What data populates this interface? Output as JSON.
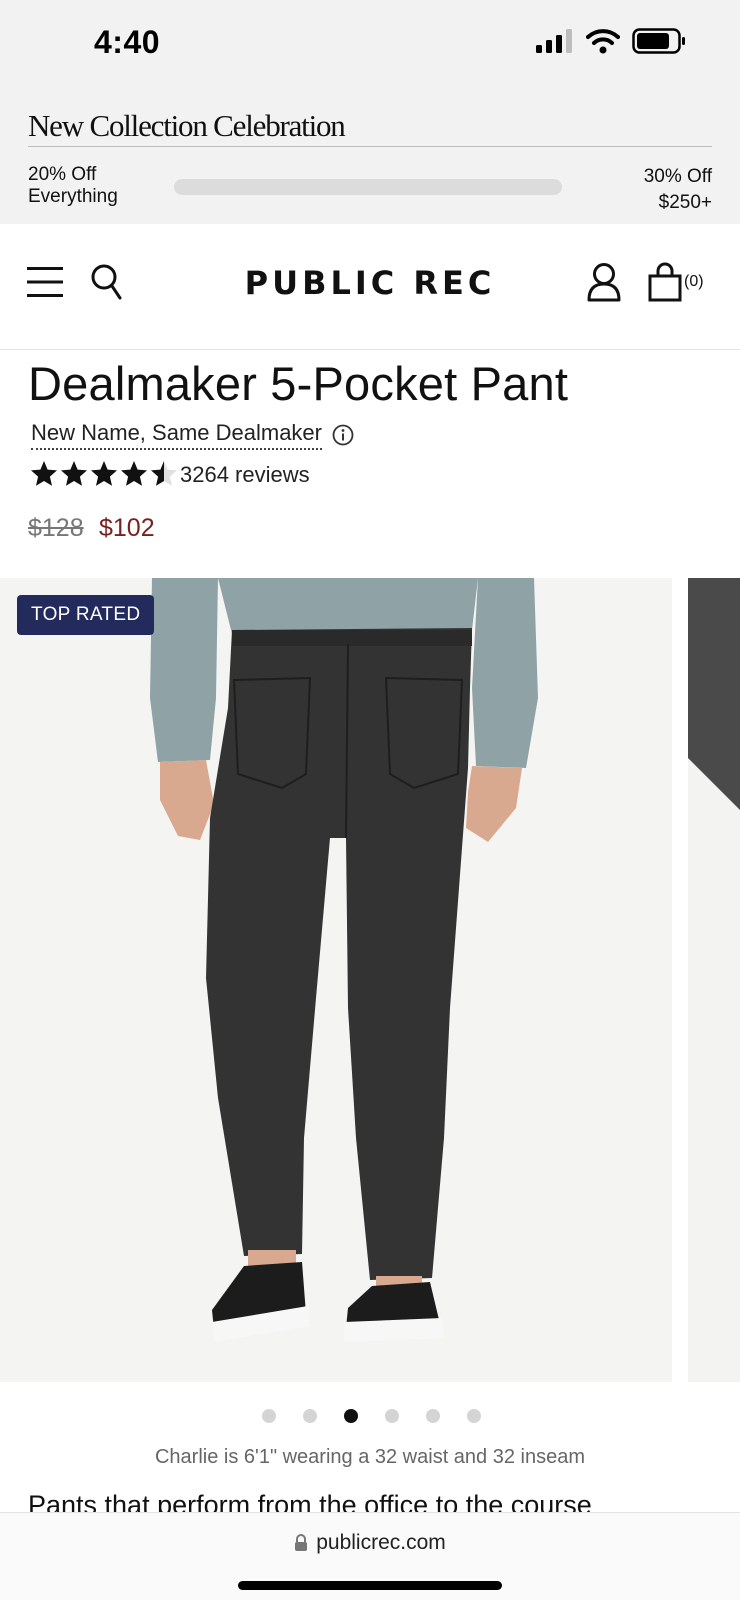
{
  "status_bar": {
    "time": "4:40"
  },
  "promo": {
    "title": "New Collection Celebration",
    "left_line1": "20% Off",
    "left_line2": "Everything",
    "right_line1": "30% Off",
    "right_line2": "$250+",
    "progress": 0
  },
  "header": {
    "logo": "PUBLIC REC",
    "cart_count": "(0)"
  },
  "product": {
    "title": "Dealmaker 5-Pocket Pant",
    "rename_note": "New Name, Same Dealmaker",
    "rating": 4.5,
    "reviews": "3264 reviews",
    "price_old": "$128",
    "price_new": "$102"
  },
  "gallery": {
    "badge": "TOP RATED",
    "slide_count": 6,
    "active_slide": 2,
    "caption": "Charlie is 6'1\" wearing a 32 waist and 32 inseam"
  },
  "description": {
    "heading": "Pants that perform from the office to the course"
  },
  "browser": {
    "url": "publicrec.com"
  },
  "colors": {
    "badge": "#232a5c",
    "sale_price": "#7a1f1f",
    "promo_bg": "#f2f2f2"
  }
}
